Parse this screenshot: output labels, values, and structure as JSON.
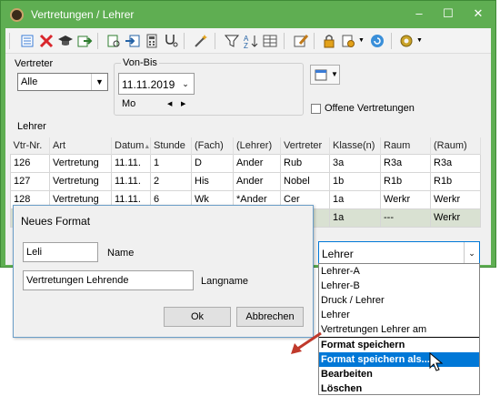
{
  "window": {
    "title": "Vertretungen / Lehrer",
    "controls": [
      "–",
      "☐",
      "✕"
    ],
    "colors": {
      "titlebar": "#5fae52",
      "accent": "#0078d7",
      "gray_row": "#d9e1d2"
    }
  },
  "toolbar": {
    "icons": [
      "list-icon",
      "delete-icon",
      "graduation-cap-icon",
      "import-icon",
      "print-preview-icon",
      "export-icon",
      "calculator-icon",
      "stethoscope-icon",
      "magic-wand-icon",
      "filter-icon",
      "sort-icon",
      "grid-icon",
      "edit-settings-icon",
      "lock-icon",
      "settings-icon",
      "refresh-icon",
      "gear-icon"
    ]
  },
  "filters": {
    "vertreter_label": "Vertreter",
    "vertreter_value": "Alle",
    "von_bis_label": "Von-Bis",
    "date_value": "11.11.2019",
    "weekday": "Mo",
    "offene_label": "Offene Vertretungen",
    "lehrer_label": "Lehrer"
  },
  "table": {
    "headers": [
      "Vtr-Nr.",
      "Art",
      "Datum",
      "Stunde",
      "(Fach)",
      "(Lehrer)",
      "Vertreter",
      "Klasse(n)",
      "Raum",
      "(Raum)"
    ],
    "rows": [
      [
        "126",
        "Vertretung",
        "11.11.",
        "1",
        "D",
        "Ander",
        "Rub",
        "3a",
        "R3a",
        "R3a"
      ],
      [
        "127",
        "Vertretung",
        "11.11.",
        "2",
        "His",
        "Ander",
        "Nobel",
        "1b",
        "R1b",
        "R1b"
      ],
      [
        "128",
        "Vertretung",
        "11.11.",
        "6",
        "Wk",
        "*Ander",
        "Cer",
        "1a",
        "Werkr",
        "Werkr"
      ],
      [
        "",
        "",
        "",
        "",
        "",
        "",
        "",
        "1a",
        "---",
        "Werkr"
      ]
    ]
  },
  "dialog": {
    "title": "Neues Format",
    "name_value": "Leli",
    "name_label": "Name",
    "langname_value": "Vertretungen Lehrende",
    "langname_label": "Langname",
    "ok_label": "Ok",
    "cancel_label": "Abbrechen"
  },
  "format_dropdown": {
    "selected": "Lehrer",
    "options": [
      "Lehrer-A",
      "Lehrer-B",
      "Druck / Lehrer",
      "Lehrer",
      "Vertretungen Lehrer am"
    ],
    "actions": [
      "Format speichern",
      "Format speichern als...",
      "Bearbeiten",
      "Löschen"
    ]
  }
}
